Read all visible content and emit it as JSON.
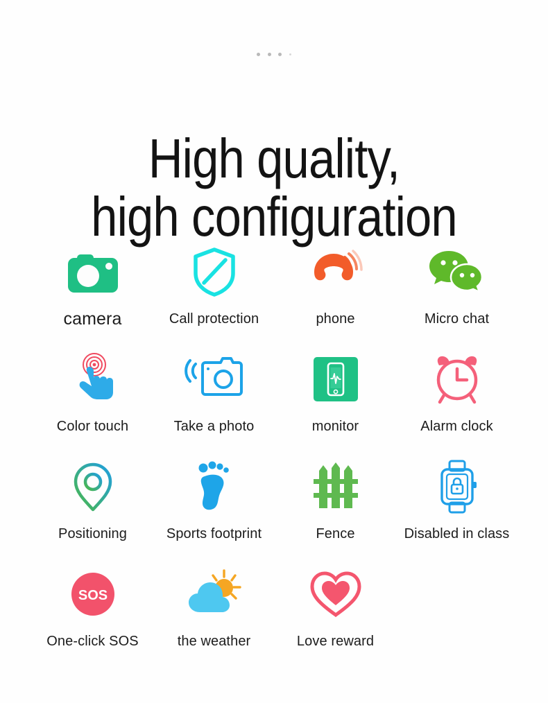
{
  "page": {
    "background": "#ffffff",
    "dots": [
      "dot",
      "dot",
      "dot",
      "dot-small"
    ]
  },
  "headline": {
    "line1": "High quality,",
    "line2": "high configuration",
    "color": "#131313"
  },
  "colors": {
    "camera_green": "#1fbf84",
    "shield_cyan": "#19e2e2",
    "phone_orange": "#f25c2a",
    "wechat_green": "#5fb92a",
    "touch_blue": "#2eabe8",
    "touch_ripple_red": "#f04a60",
    "photo_blue": "#1ca3e8",
    "monitor_green": "#1fc185",
    "alarm_pink": "#f4607a",
    "pin_green": "#4cb847",
    "pin_blue": "#1f9fe0",
    "footprint_blue": "#1ea5e8",
    "fence_green": "#5fb950",
    "watch_blue": "#1f9fe8",
    "sos_pink": "#f2526b",
    "cloud_blue": "#4ec8f0",
    "sun_orange": "#f5a623",
    "heart_pink": "#f4566e",
    "label_text": "#1c1c1c"
  },
  "features": {
    "rows": [
      {
        "items": [
          {
            "label": "camera",
            "icon": "camera-filled-icon",
            "emphasis": true
          },
          {
            "label": "Call protection",
            "icon": "shield-block-icon",
            "emphasis": false
          },
          {
            "label": "phone",
            "icon": "phone-ringing-icon",
            "emphasis": false
          },
          {
            "label": "Micro chat",
            "icon": "wechat-bubbles-icon",
            "emphasis": false
          }
        ]
      },
      {
        "items": [
          {
            "label": "Color touch",
            "icon": "touch-hand-icon",
            "emphasis": false
          },
          {
            "label": "Take a photo",
            "icon": "camera-outline-icon",
            "emphasis": false
          },
          {
            "label": "monitor",
            "icon": "phone-monitor-icon",
            "emphasis": false
          },
          {
            "label": "Alarm clock",
            "icon": "alarm-clock-icon",
            "emphasis": false
          }
        ]
      },
      {
        "items": [
          {
            "label": "Positioning",
            "icon": "map-pin-icon",
            "emphasis": false
          },
          {
            "label": "Sports footprint",
            "icon": "footprint-icon",
            "emphasis": false
          },
          {
            "label": "Fence",
            "icon": "fence-icon",
            "emphasis": false
          },
          {
            "label": "Disabled in class",
            "icon": "watch-lock-icon",
            "emphasis": false
          }
        ]
      },
      {
        "items": [
          {
            "label": "One-click SOS",
            "icon": "sos-badge-icon",
            "emphasis": false
          },
          {
            "label": "the weather",
            "icon": "weather-cloud-sun-icon",
            "emphasis": false
          },
          {
            "label": "Love reward",
            "icon": "heart-icon",
            "emphasis": false
          }
        ]
      }
    ]
  },
  "sos": {
    "text": "SOS"
  }
}
